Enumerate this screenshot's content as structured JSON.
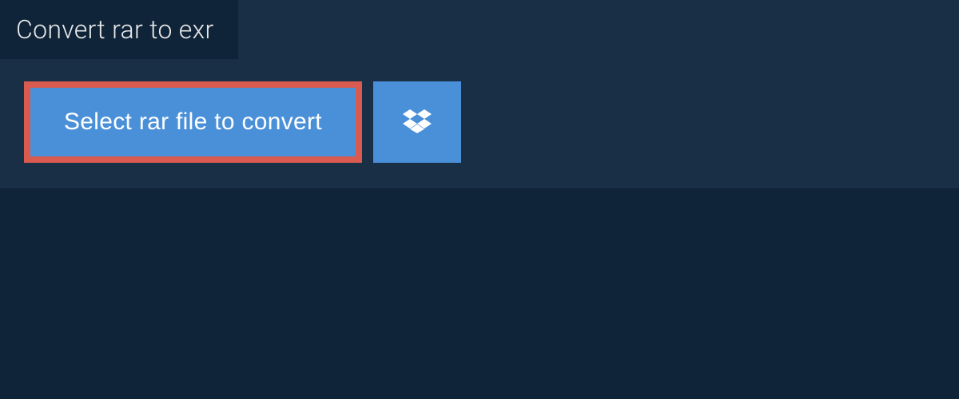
{
  "tab": {
    "title": "Convert rar to exr"
  },
  "actions": {
    "select_file_label": "Select rar file to convert"
  },
  "colors": {
    "page_bg": "#0f2438",
    "panel_bg": "#182f45",
    "button_bg": "#4a90d9",
    "highlight_border": "#d95b4f",
    "text_light": "#e8e8e8",
    "text_white": "#ffffff"
  }
}
